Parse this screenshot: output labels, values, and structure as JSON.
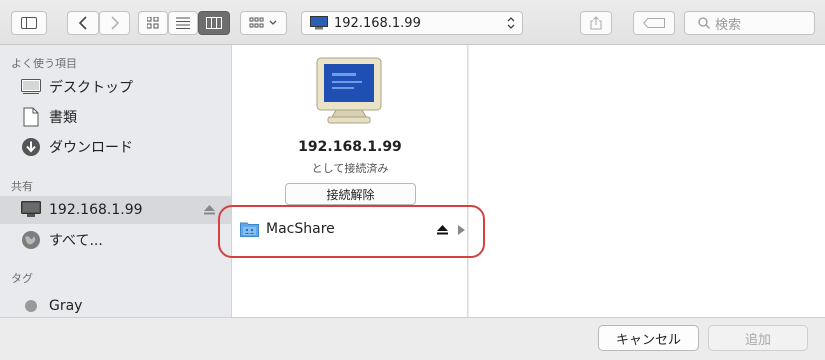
{
  "toolbar": {
    "path_label": "192.168.1.99",
    "search_placeholder": "検索"
  },
  "sidebar": {
    "sections": [
      {
        "label": "よく使う項目"
      },
      {
        "label": "共有"
      },
      {
        "label": "タグ"
      }
    ],
    "favorites": [
      {
        "label": "デスクトップ",
        "icon": "desktop-icon"
      },
      {
        "label": "書類",
        "icon": "document-icon"
      },
      {
        "label": "ダウンロード",
        "icon": "download-icon"
      }
    ],
    "shared": [
      {
        "label": "192.168.1.99",
        "icon": "computer-icon",
        "selected": true
      },
      {
        "label": "すべて...",
        "icon": "network-icon"
      }
    ],
    "tags": [
      {
        "label": "Gray",
        "color": "#9a9a9a"
      }
    ]
  },
  "column": {
    "host_name": "192.168.1.99",
    "host_status": "として接続済み",
    "disconnect_label": "接続解除",
    "share_name": "MacShare"
  },
  "buttons": {
    "cancel_label": "キャンセル",
    "add_label": "追加"
  },
  "colors": {
    "accent": "#1f6fd6",
    "highlight_ring": "#d64040"
  }
}
